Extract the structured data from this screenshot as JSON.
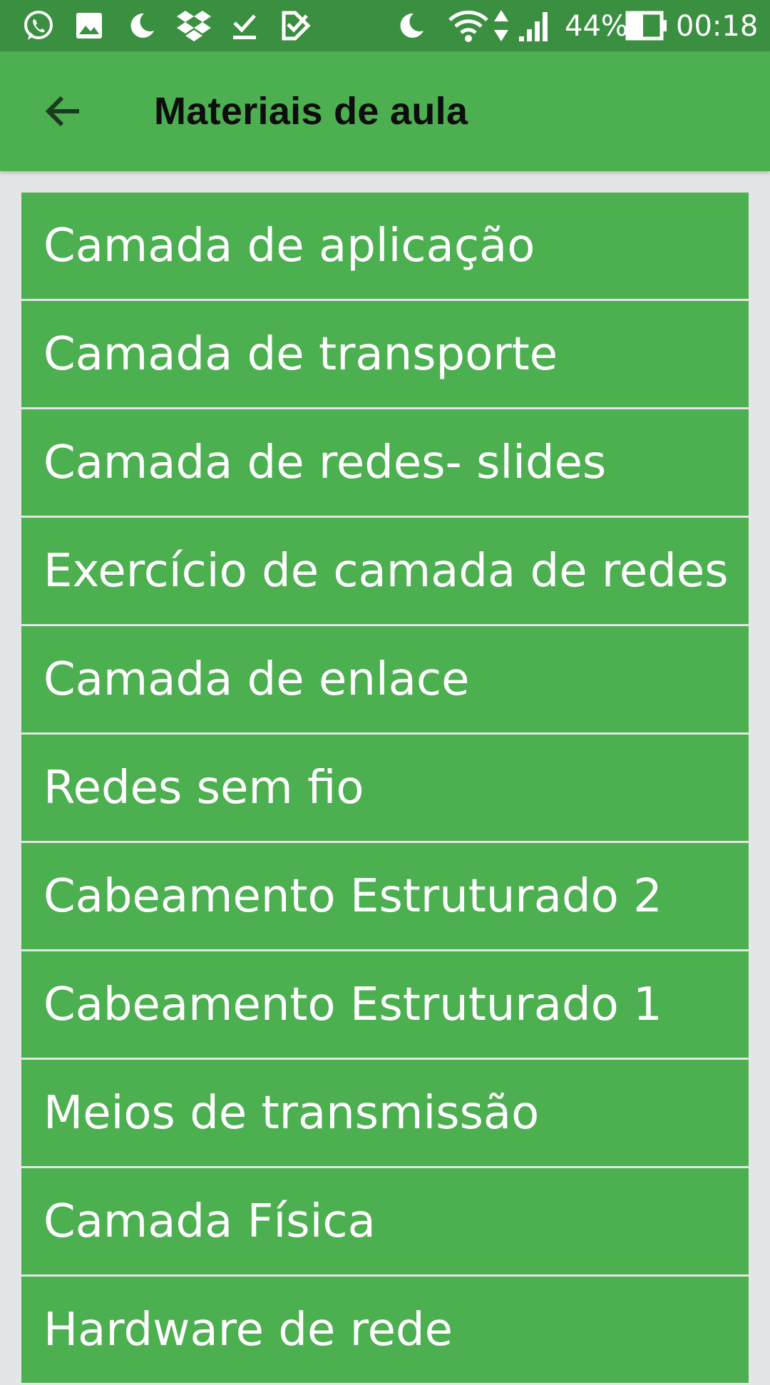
{
  "status_bar": {
    "icons": [
      "whatsapp-icon",
      "image-icon",
      "moon-icon",
      "dropbox-icon",
      "download-done-icon",
      "task-icon",
      "moon-icon",
      "wifi-icon",
      "data-arrows-icon",
      "signal-icon",
      "battery-icon"
    ],
    "battery_percent": "44%",
    "time": "00:18"
  },
  "app_bar": {
    "title": "Materiais de aula",
    "back_icon": "arrow-left-icon"
  },
  "materials": {
    "items": [
      {
        "label": "Camada de aplicação"
      },
      {
        "label": "Camada de transporte"
      },
      {
        "label": "Camada de redes- slides"
      },
      {
        "label": "Exercício de camada de redes"
      },
      {
        "label": "Camada de enlace"
      },
      {
        "label": "Redes sem fio"
      },
      {
        "label": "Cabeamento Estruturado 2"
      },
      {
        "label": "Cabeamento Estruturado 1"
      },
      {
        "label": "Meios de transmissão"
      },
      {
        "label": "Camada Física"
      },
      {
        "label": "Hardware de rede"
      }
    ]
  },
  "colors": {
    "status_bar": "#3b8f40",
    "app_bar": "#4caf50",
    "list_item": "#4caf50",
    "background": "#e4e5e7"
  }
}
